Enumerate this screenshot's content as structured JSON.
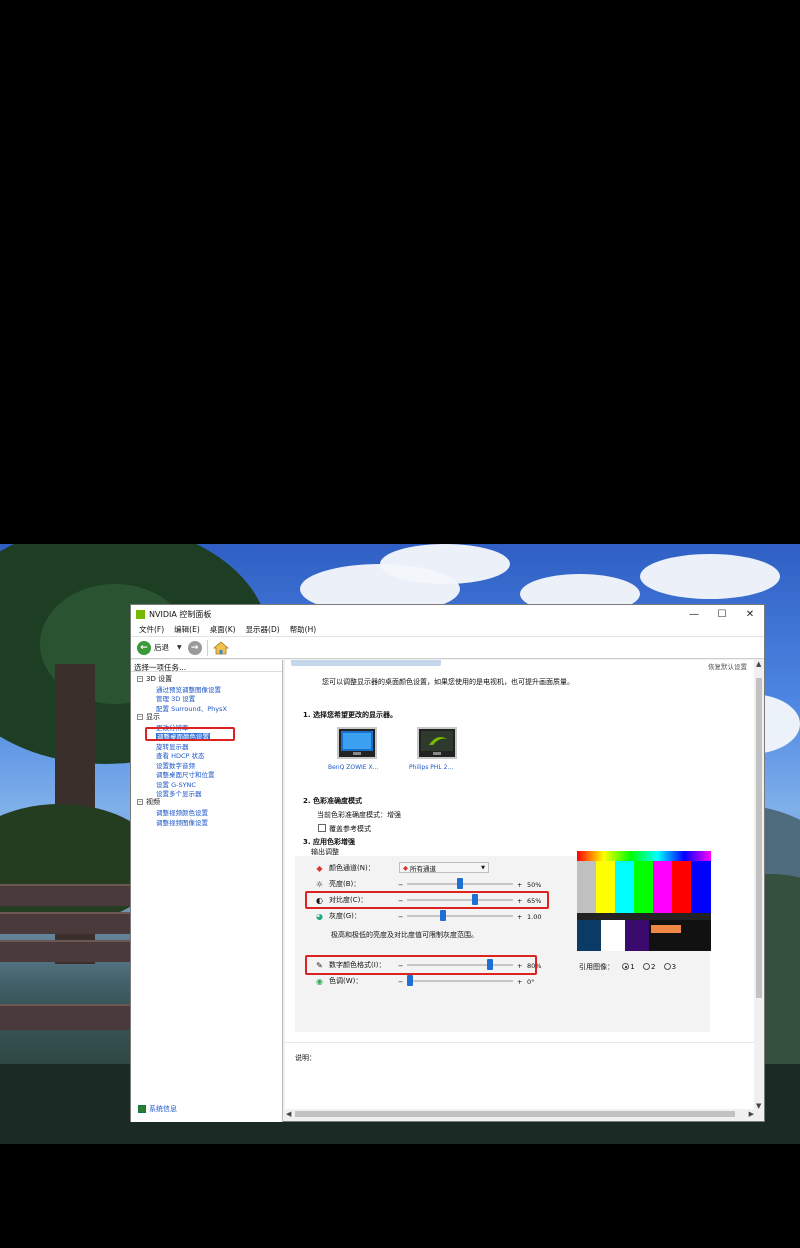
{
  "window": {
    "title": "NVIDIA 控制面板",
    "min_icon": "minimize-icon",
    "max_icon": "maximize-icon",
    "close_icon": "close-icon"
  },
  "menu": [
    "文件(F)",
    "编辑(E)",
    "桌面(K)",
    "显示器(D)",
    "帮助(H)"
  ],
  "toolbar": {
    "back_label": "后退"
  },
  "left_panel": {
    "title": "选择一项任务...",
    "categories": [
      {
        "label": "3D 设置",
        "items": [
          "通过预览调整图像设置",
          "管理 3D 设置",
          "配置 Surround、PhysX"
        ]
      },
      {
        "label": "显示",
        "items": [
          "更改分辨率",
          "调整桌面颜色设置",
          "旋转显示器",
          "查看 HDCP 状态",
          "设置数字音频",
          "调整桌面尺寸和位置",
          "设置 G-SYNC",
          "设置多个显示器"
        ]
      },
      {
        "label": "视频",
        "items": [
          "调整视频颜色设置",
          "调整视频图像设置"
        ]
      }
    ],
    "selected_item": "调整桌面颜色设置",
    "system_info": "系统信息"
  },
  "right_panel": {
    "restore_link": "恢复默认设置",
    "intro": "您可以调整显示器的桌面颜色设置，如果您使用的是电视机，也可提升画面质量。",
    "section1": "1. 选择您希望更改的显示器。",
    "monitors": [
      {
        "label": "BenQ ZOWIE X..."
      },
      {
        "label": "Philips PHL 2..."
      }
    ],
    "section2": "2. 色彩准确度模式",
    "current_mode": "当前色彩准确度模式：增强",
    "override_reference": "覆盖参考模式",
    "section3": "3. 应用色彩增强",
    "output_adjust": "输出调整",
    "channel_label": "颜色通道(N)：",
    "channel_value": "所有通道",
    "sliders": [
      {
        "label": "亮度(B)：",
        "value_text": "50%",
        "fraction": 0.5,
        "icon": "sun-icon"
      },
      {
        "label": "对比度(C)：",
        "value_text": "65%",
        "fraction": 0.65,
        "icon": "contrast-icon"
      },
      {
        "label": "灰度(G)：",
        "value_text": "1.00",
        "fraction": 0.33,
        "icon": "gamma-icon"
      }
    ],
    "note": "极高和极低的亮度及对比度值可限制灰度范围。",
    "vibrance": {
      "label": "数字颜色格式(I)：",
      "value_text": "80%",
      "fraction": 0.8
    },
    "hue": {
      "label": "色调(W)：",
      "value_text": "0°",
      "fraction": 0.0
    },
    "reference_label": "引用图像：",
    "reference_options": [
      "1",
      "2",
      "3"
    ],
    "reference_selected": "1",
    "description_label": "说明："
  },
  "colors": {
    "highlight": "#d22222",
    "slider": "#1e6fd2",
    "link": "#1a55c8",
    "nvidia_green": "#76b900"
  }
}
